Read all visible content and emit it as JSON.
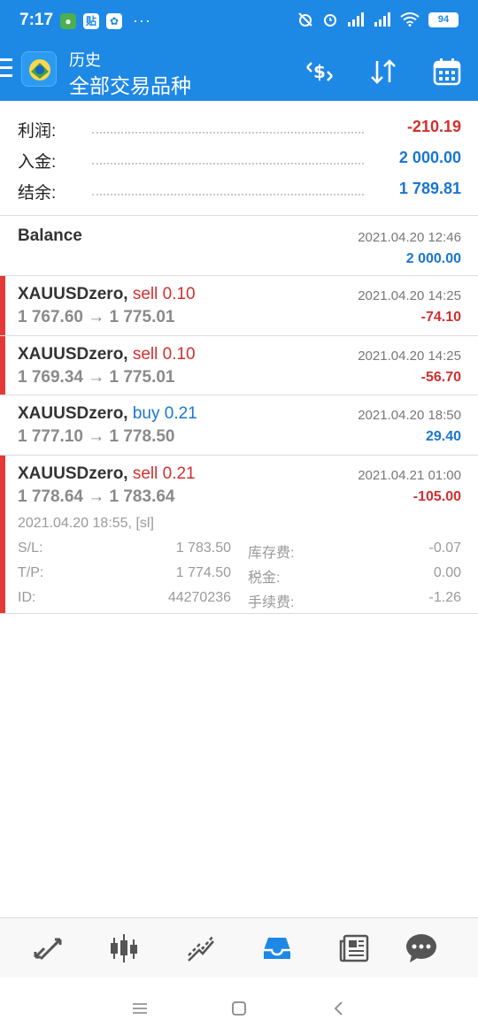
{
  "status_bar": {
    "time": "7:17",
    "battery": "94",
    "left_icons": [
      "wechat-icon",
      "tieba-icon",
      "dingtalk-icon"
    ],
    "more": "···"
  },
  "app_bar": {
    "title": "历史",
    "subtitle": "全部交易品种",
    "actions": [
      "currency-swap-icon",
      "sort-icon",
      "calendar-icon"
    ]
  },
  "summary": {
    "rows": [
      {
        "label": "利润:",
        "value": "-210.19",
        "color": "#d32f2f"
      },
      {
        "label": "入金:",
        "value": "2 000.00",
        "color": "#1976d2"
      },
      {
        "label": "结余:",
        "value": "1 789.81",
        "color": "#1976d2"
      }
    ]
  },
  "balance": {
    "label": "Balance",
    "time": "2021.04.20 12:46",
    "amount": "2 000.00"
  },
  "trades": [
    {
      "symbol": "XAUUSDzero,",
      "type": "sell 0.10",
      "prices": "1 767.60 → 1 775.01",
      "time": "2021.04.20 14:25",
      "profit": "-74.10"
    },
    {
      "symbol": "XAUUSDzero,",
      "type": "sell 0.10",
      "prices": "1 769.34 → 1 775.01",
      "time": "2021.04.20 14:25",
      "profit": "-56.70"
    },
    {
      "symbol": "XAUUSDzero,",
      "type": "buy 0.21",
      "prices": "1 777.10 → 1 778.50",
      "time": "2021.04.20 18:50",
      "profit": "29.40"
    },
    {
      "symbol": "XAUUSDzero,",
      "type": "sell 0.21",
      "prices": "1 778.64 → 1 783.64",
      "time": "2021.04.21 01:00",
      "profit": "-105.00"
    }
  ],
  "expanded_details": {
    "open_info": "2021.04.20 18:55, [sl]",
    "sl_label": "S/L:",
    "sl_value": "1 783.50",
    "tp_label": "T/P:",
    "tp_value": "1 774.50",
    "id_label": "ID:",
    "id_value": "44270236",
    "swap_label": "库存费:",
    "swap_value": "-0.07",
    "tax_label": "税金:",
    "tax_value": "0.00",
    "fee_label": "手续费:",
    "fee_value": "-1.26"
  },
  "colors": {
    "accent": "#1e88e5",
    "sell": "#d32f2f",
    "buy": "#1976d2",
    "bar_sell": "#e53935",
    "bar_buy": "#ffffff"
  },
  "bottom_nav": [
    "quotes-icon",
    "chart-icon",
    "trade-icon",
    "history-icon",
    "news-icon",
    "chat-icon"
  ],
  "system_nav": [
    "menu-icon",
    "home-icon",
    "back-icon"
  ]
}
